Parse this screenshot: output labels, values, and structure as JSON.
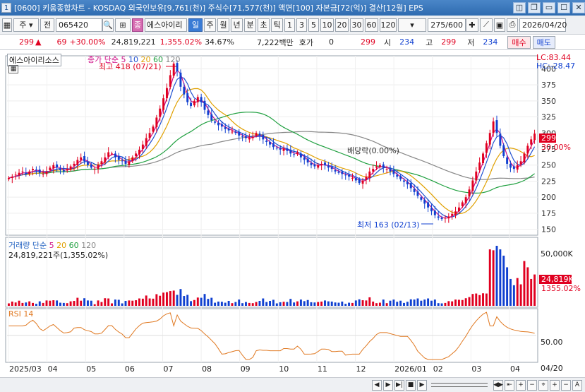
{
  "window": {
    "number": "1",
    "title": "[0600] 키움종합차트 - KOSDAQ 외국인보유[9,761(천)] 주식수[71,577(천)] 액면[100] 자본금[72(억)] 결산[12월] EPS",
    "buttons": [
      "◫",
      "❐",
      "▭",
      "☐",
      "✕"
    ]
  },
  "toolbar": {
    "stock_type": "주",
    "prev_label": "전",
    "code": "065420",
    "menu_icon": "⊞",
    "stock_badge": "종",
    "stock_name": "에스아이리",
    "periods": [
      "일",
      "주",
      "월",
      "년",
      "분",
      "초",
      "틱"
    ],
    "active_period": "일",
    "intervals": [
      "1",
      "3",
      "5",
      "10",
      "20",
      "30",
      "60",
      "120"
    ],
    "count": "275",
    "count_total": "/600",
    "date": "2026/04/20"
  },
  "quote": {
    "price": "299",
    "change": "69",
    "change_pct": "+30.00%",
    "volume": "24,819,221",
    "volume_pct": "1,355.02%",
    "turnover": "34.67%",
    "amount": "7,222백만",
    "hoga_label": "호가",
    "hoga_value": "0",
    "open_price": "299",
    "open_label": "시",
    "open_value": "234",
    "high_label": "고",
    "high_value": "299",
    "low_label": "저",
    "low_value": "234",
    "buy_label": "매수",
    "sell_label": "매도"
  },
  "chart": {
    "stock_title": "에스아이리소스",
    "legend_price": {
      "prefix": "종가 단순",
      "periods": [
        "5",
        "10",
        "20",
        "60",
        "120"
      ]
    },
    "high_annotation": "최고 418 (07/21)",
    "low_annotation": "최저 163 (02/13)",
    "dividend_annotation": "배당락(0.00%)",
    "lc_label": "LC:83.44",
    "hc_label": "HC:-28.47",
    "current_price_tag": "299",
    "current_pct_tag": "30.00%",
    "volume_legend": {
      "prefix": "거래량 단순",
      "periods": [
        "5",
        "20",
        "60",
        "120"
      ]
    },
    "volume_value": "24,819,221주(1,355.02%)",
    "volume_tag": "24,819K",
    "volume_pct_tag": "1355.02%",
    "volume_axis_label": "50,000K",
    "rsi_legend": "RSI 14",
    "rsi_axis_label": "50.00",
    "date_end_label": "04/20"
  },
  "chart_data": {
    "type": "candlestick",
    "price_axis": {
      "ticks": [
        "400",
        "375",
        "350",
        "325",
        "300",
        "275",
        "250",
        "225",
        "200",
        "175",
        "150"
      ],
      "ylim": [
        143,
        418
      ]
    },
    "x_labels": [
      "2025/03",
      "04",
      "05",
      "06",
      "07",
      "08",
      "09",
      "10",
      "11",
      "12",
      "2026/01",
      "02",
      "03",
      "04"
    ],
    "close_series": [
      230,
      232,
      235,
      238,
      240,
      236,
      240,
      244,
      242,
      238,
      236,
      240,
      246,
      250,
      246,
      242,
      240,
      244,
      248,
      252,
      258,
      262,
      256,
      250,
      246,
      244,
      250,
      256,
      262,
      270,
      268,
      262,
      258,
      256,
      252,
      256,
      262,
      268,
      274,
      282,
      292,
      300,
      310,
      324,
      338,
      354,
      370,
      390,
      408,
      396,
      372,
      360,
      348,
      342,
      350,
      356,
      348,
      336,
      328,
      320,
      316,
      312,
      310,
      306,
      304,
      302,
      300,
      296,
      294,
      292,
      292,
      294,
      300,
      296,
      290,
      286,
      282,
      278,
      276,
      274,
      276,
      272,
      268,
      266,
      270,
      262,
      258,
      254,
      250,
      248,
      250,
      252,
      250,
      246,
      244,
      240,
      238,
      236,
      234,
      232,
      230,
      226,
      222,
      226,
      232,
      240,
      244,
      248,
      250,
      246,
      244,
      240,
      236,
      232,
      228,
      224,
      220,
      214,
      208,
      202,
      196,
      190,
      184,
      178,
      172,
      168,
      166,
      168,
      170,
      174,
      178,
      184,
      192,
      200,
      212,
      226,
      240,
      254,
      268,
      284,
      300,
      318,
      300,
      280,
      264,
      252,
      246,
      244,
      250,
      256,
      268,
      280,
      290,
      299
    ]
  },
  "colors": {
    "up": "#e00020",
    "down": "#1040d0",
    "ma5": "#d01088",
    "ma10": "#2050d0",
    "ma20": "#e0a000",
    "ma60": "#20a040",
    "ma120": "#888888",
    "rsi": "#e07820"
  },
  "bottom": {
    "buttons": [
      "◀",
      "▶",
      "▶|",
      "■",
      "▶",
      "◀▶",
      "⇤",
      "+",
      "−",
      "⌖",
      "+",
      "−",
      "A"
    ]
  }
}
